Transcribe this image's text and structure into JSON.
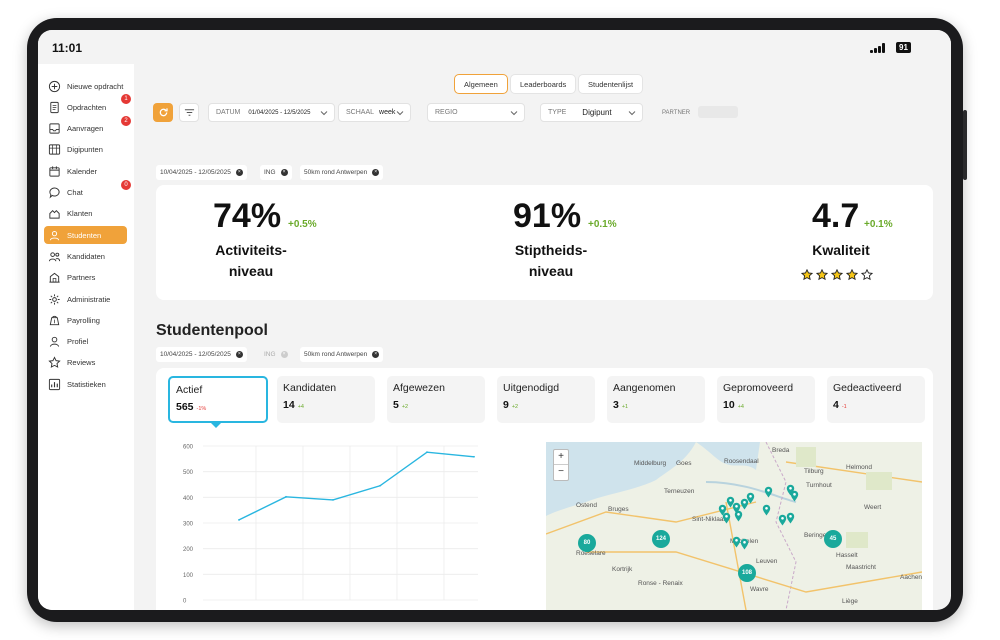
{
  "status": {
    "time": "11:01",
    "battery": "91"
  },
  "sidebar": {
    "items": [
      {
        "label": "Nieuwe opdracht",
        "icon": "plus-circle-icon"
      },
      {
        "label": "Opdrachten",
        "icon": "document-icon",
        "badge": "1"
      },
      {
        "label": "Aanvragen",
        "icon": "inbox-icon",
        "badge": "2"
      },
      {
        "label": "Digipunten",
        "icon": "grid-icon"
      },
      {
        "label": "Kalender",
        "icon": "calendar-icon"
      },
      {
        "label": "Chat",
        "icon": "chat-icon",
        "badge": "0"
      },
      {
        "label": "Klanten",
        "icon": "clients-icon"
      },
      {
        "label": "Studenten",
        "icon": "students-icon",
        "active": true
      },
      {
        "label": "Kandidaten",
        "icon": "candidates-icon"
      },
      {
        "label": "Partners",
        "icon": "partners-icon"
      },
      {
        "label": "Administratie",
        "icon": "administration-icon"
      },
      {
        "label": "Payrolling",
        "icon": "payroll-icon"
      },
      {
        "label": "Profiel",
        "icon": "profile-icon"
      },
      {
        "label": "Reviews",
        "icon": "star-icon"
      },
      {
        "label": "Statistieken",
        "icon": "stats-icon"
      }
    ]
  },
  "tabs": [
    {
      "label": "Algemeen",
      "active": true
    },
    {
      "label": "Leaderboards"
    },
    {
      "label": "Studentenlijst"
    }
  ],
  "filters": {
    "datum_label": "DATUM",
    "datum_value": "01/04/2025 - 12/5/2025",
    "schaal_label": "SCHAAL",
    "schaal_value": "week",
    "regio_label": "REGIO",
    "type_label": "TYPE",
    "type_value": "Digipunt",
    "partner_label": "PARTNER"
  },
  "chips_top": [
    "10/04/2025 - 12/05/2025",
    "ING",
    "50km rond Antwerpen"
  ],
  "kpis": [
    {
      "value": "74%",
      "delta": "+0.5%",
      "label_1": "Activiteits-",
      "label_2": "niveau"
    },
    {
      "value": "91%",
      "delta": "+0.1%",
      "label_1": "Stiptheids-",
      "label_2": "niveau"
    },
    {
      "value": "4.7",
      "delta": "+0.1%",
      "label_1": "Kwaliteit",
      "stars": 4,
      "stars_total": 5
    }
  ],
  "pool": {
    "title": "Studentenpool",
    "chips": [
      "10/04/2025 - 12/05/2025",
      "ING",
      "50km rond Antwerpen"
    ],
    "stats": [
      {
        "name": "Actief",
        "value": "565",
        "delta": "-1%",
        "active": true
      },
      {
        "name": "Kandidaten",
        "value": "14",
        "delta": "+4"
      },
      {
        "name": "Afgewezen",
        "value": "5",
        "delta": "+2"
      },
      {
        "name": "Uitgenodigd",
        "value": "9",
        "delta": "+2"
      },
      {
        "name": "Aangenomen",
        "value": "3",
        "delta": "+1"
      },
      {
        "name": "Gepromoveerd",
        "value": "10",
        "delta": "+4"
      },
      {
        "name": "Gedeactiveerd",
        "value": "4",
        "delta": "-1"
      }
    ]
  },
  "chart_data": {
    "type": "line",
    "x": [
      1,
      2,
      3,
      4,
      5,
      6
    ],
    "values": [
      312,
      402,
      390,
      445,
      576,
      558
    ],
    "yticks": [
      "600",
      "500",
      "400",
      "300",
      "200",
      "100",
      "0"
    ],
    "ylim": [
      0,
      600
    ],
    "color": "#29b6e0"
  },
  "map": {
    "zoom_in": "+",
    "zoom_out": "−",
    "cities": [
      "Middelburg",
      "Goes",
      "Roosendaal",
      "Breda",
      "Tilburg",
      "Helmond",
      "Terneuzen",
      "Ostend",
      "Bruges",
      "Sint-Niklaas",
      "Turnhout",
      "Weert",
      "Mechelen",
      "Beringen",
      "Kortrijk",
      "Leuven",
      "Hasselt",
      "Roeselare",
      "Ronse - Renaix",
      "Wavre",
      "Maastricht",
      "Aachen",
      "Liège"
    ],
    "clusters": [
      "80",
      "124",
      "108",
      "45"
    ]
  },
  "colors": {
    "accent": "#f0a23a",
    "active_border": "#29b6e0",
    "positive": "#6aaa2a",
    "negative": "#e53935",
    "map_marker": "#1aa99c"
  }
}
